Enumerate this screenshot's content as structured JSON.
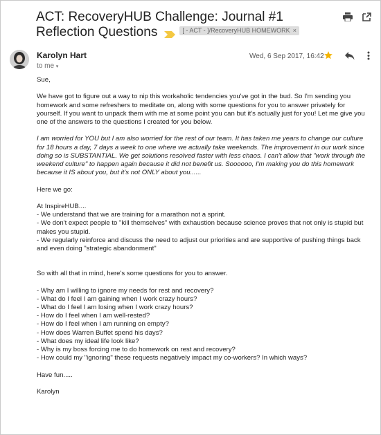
{
  "subject": {
    "title": "ACT: RecoveryHUB Challenge: Journal #1 Reflection Questions",
    "label": "[ - ACT - ]/RecoveryHUB HOMEWORK",
    "label_close": "×"
  },
  "message": {
    "sender": "Karolyn Hart",
    "to": "to me",
    "date": "Wed, 6 Sep 2017, 16:42"
  },
  "icons": {
    "print": "print-icon",
    "open_new_window": "open-in-new-icon",
    "star": "star-icon",
    "reply": "reply-icon",
    "more": "more-vert-icon",
    "importance": "importance-marker-icon"
  },
  "colors": {
    "star": "#f4b400",
    "importance": "#f4c842",
    "label_bg": "#dddddd"
  },
  "body": {
    "greeting": "Sue,",
    "p1": "We have got to figure out a way to nip this workaholic tendencies you've got in the bud.  So I'm sending you homework and some refreshers to meditate on, along with some questions for you to answer privately for yourself.  If you want to unpack them with me at some point you can but it's actually just for you! Let me give you one of the answers to the questions I created for you below.",
    "p2": "I am worried for YOU but I am also worried for the rest of our team.  It has taken me years to change our culture for 18 hours a day, 7 days a week to one where we actually take weekends. The improvement in our work since doing so is SUBSTANTIAL.  We get solutions resolved faster with less chaos. I can't allow that \"work through the weekend culture\" to happen again because it did not benefit us.  Soooooo, I'm making you do this homework because it IS about you, but it's not ONLY about you......",
    "p3": "Here we go:",
    "p4_lines": [
      "At InspireHUB....",
      "- We understand that we are training for a marathon not a sprint.",
      "- We don't expect people to \"kill themselves\" with exhaustion because science proves that not only is stupid but makes you stupid.",
      "- We regularly reinforce and discuss the need to adjust our priorities and are supportive of pushing things back and even doing \"strategic abandonment\""
    ],
    "p5": "So with all that in mind, here's some questions for you to answer.",
    "questions": [
      "- Why am I willing to ignore my needs for rest and recovery?",
      "- What do I feel I am gaining when I work crazy hours?",
      "- What do I feel I am losing when I work crazy hours?",
      "- How do I feel when I am well-rested?",
      "- How do I feel when I am running on empty?",
      "- How does Warren Buffet spend his days?",
      "- What does my ideal life look like?",
      "- Why is my boss forcing me to do homework on rest and recovery?",
      "- How could my \"ignoring\" these requests negatively impact my co-workers? In which ways?"
    ],
    "closing": "Have fun.....",
    "signature": "Karolyn"
  }
}
